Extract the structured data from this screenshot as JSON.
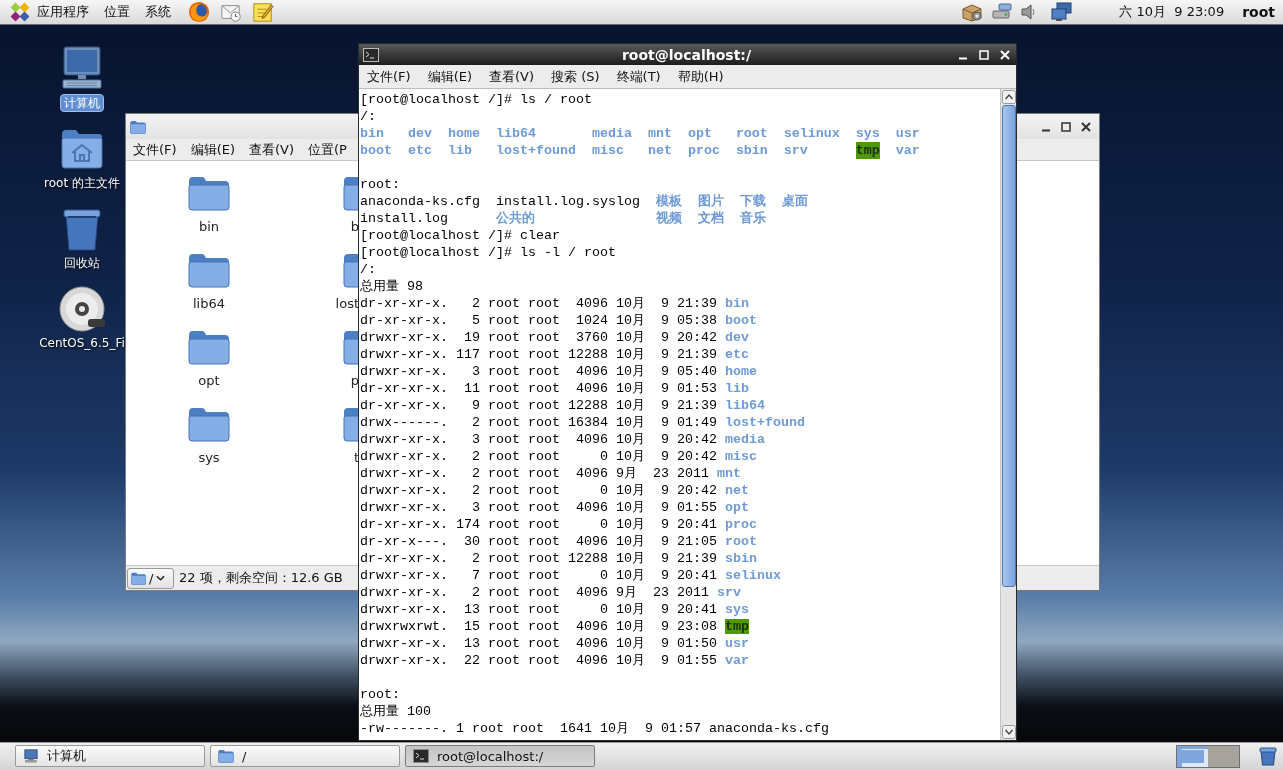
{
  "top_panel": {
    "menus": [
      "应用程序",
      "位置",
      "系统"
    ],
    "clock": "六 10月  9 23:09",
    "user": "root"
  },
  "desktop_icons": [
    {
      "kind": "computer",
      "label": "计算机",
      "selected": true
    },
    {
      "kind": "home",
      "label": "root 的主文件",
      "selected": false
    },
    {
      "kind": "trash",
      "label": "回收站",
      "selected": false
    },
    {
      "kind": "disc",
      "label": "CentOS_6.5_Fi",
      "selected": false
    }
  ],
  "file_manager": {
    "menu": [
      "文件(F)",
      "编辑(E)",
      "查看(V)",
      "位置(P"
    ],
    "rows": [
      [
        "bin",
        "b"
      ],
      [
        "lib64",
        "lost"
      ],
      [
        "opt",
        "p"
      ],
      [
        "sys",
        "t"
      ]
    ],
    "path": "/",
    "status": "22 项，剩余空间：12.6 GB"
  },
  "terminal": {
    "title": "root@localhost:/",
    "menu": [
      "文件(F)",
      "编辑(E)",
      "查看(V)",
      "搜索 (S)",
      "终端(T)",
      "帮助(H)"
    ],
    "lines": [
      {
        "kind": "text",
        "text": "[root@localhost /]# ls / root"
      },
      {
        "kind": "text",
        "text": "/:"
      },
      {
        "kind": "grid",
        "rows": [
          [
            {
              "name": "bin",
              "kind": "dir"
            },
            {
              "name": "dev",
              "kind": "dir"
            },
            {
              "name": "home",
              "kind": "dir"
            },
            {
              "name": "lib64",
              "kind": "dir"
            },
            {
              "name": "media",
              "kind": "dir"
            },
            {
              "name": "mnt",
              "kind": "dir"
            },
            {
              "name": "opt",
              "kind": "dir"
            },
            {
              "name": "root",
              "kind": "dir"
            },
            {
              "name": "selinux",
              "kind": "dir"
            },
            {
              "name": "sys",
              "kind": "dir"
            },
            {
              "name": "usr",
              "kind": "dir"
            }
          ],
          [
            {
              "name": "boot",
              "kind": "dir"
            },
            {
              "name": "etc",
              "kind": "dir"
            },
            {
              "name": "lib",
              "kind": "dir"
            },
            {
              "name": "lost+found",
              "kind": "dir"
            },
            {
              "name": "misc",
              "kind": "dir"
            },
            {
              "name": "net",
              "kind": "dir"
            },
            {
              "name": "proc",
              "kind": "dir"
            },
            {
              "name": "sbin",
              "kind": "dir"
            },
            {
              "name": "srv",
              "kind": "dir"
            },
            {
              "name": "tmp",
              "kind": "sticky"
            },
            {
              "name": "var",
              "kind": "dir"
            }
          ]
        ]
      },
      {
        "kind": "blank"
      },
      {
        "kind": "text",
        "text": "root:"
      },
      {
        "kind": "grid",
        "rows": [
          [
            {
              "name": "anaconda-ks.cfg",
              "kind": "file"
            },
            {
              "name": "install.log.syslog",
              "kind": "file"
            },
            {
              "name": "模板",
              "kind": "dir"
            },
            {
              "name": "图片",
              "kind": "dir"
            },
            {
              "name": "下载",
              "kind": "dir"
            },
            {
              "name": "桌面",
              "kind": "dir"
            }
          ],
          [
            {
              "name": "install.log",
              "kind": "file"
            },
            {
              "name": "公共的",
              "kind": "dir"
            },
            {
              "name": "视频",
              "kind": "dir"
            },
            {
              "name": "文档",
              "kind": "dir"
            },
            {
              "name": "音乐",
              "kind": "dir"
            }
          ]
        ]
      },
      {
        "kind": "text",
        "text": "[root@localhost /]# clear"
      },
      {
        "kind": "text",
        "text": "[root@localhost /]# ls -l / root"
      },
      {
        "kind": "text",
        "text": "/:"
      },
      {
        "kind": "text",
        "text": "总用量 98"
      },
      {
        "kind": "long",
        "details": "dr-xr-xr-x.   2 root root  4096 10月  9 21:39",
        "entry": {
          "name": "bin",
          "kind": "dir"
        }
      },
      {
        "kind": "long",
        "details": "dr-xr-xr-x.   5 root root  1024 10月  9 05:38",
        "entry": {
          "name": "boot",
          "kind": "dir"
        }
      },
      {
        "kind": "long",
        "details": "drwxr-xr-x.  19 root root  3760 10月  9 20:42",
        "entry": {
          "name": "dev",
          "kind": "dir"
        }
      },
      {
        "kind": "long",
        "details": "drwxr-xr-x. 117 root root 12288 10月  9 21:39",
        "entry": {
          "name": "etc",
          "kind": "dir"
        }
      },
      {
        "kind": "long",
        "details": "drwxr-xr-x.   3 root root  4096 10月  9 05:40",
        "entry": {
          "name": "home",
          "kind": "dir"
        }
      },
      {
        "kind": "long",
        "details": "dr-xr-xr-x.  11 root root  4096 10月  9 01:53",
        "entry": {
          "name": "lib",
          "kind": "dir"
        }
      },
      {
        "kind": "long",
        "details": "dr-xr-xr-x.   9 root root 12288 10月  9 21:39",
        "entry": {
          "name": "lib64",
          "kind": "dir"
        }
      },
      {
        "kind": "long",
        "details": "drwx------.   2 root root 16384 10月  9 01:49",
        "entry": {
          "name": "lost+found",
          "kind": "dir"
        }
      },
      {
        "kind": "long",
        "details": "drwxr-xr-x.   3 root root  4096 10月  9 20:42",
        "entry": {
          "name": "media",
          "kind": "dir"
        }
      },
      {
        "kind": "long",
        "details": "drwxr-xr-x.   2 root root     0 10月  9 20:42",
        "entry": {
          "name": "misc",
          "kind": "dir"
        }
      },
      {
        "kind": "long",
        "details": "drwxr-xr-x.   2 root root  4096 9月  23 2011",
        "entry": {
          "name": "mnt",
          "kind": "dir"
        }
      },
      {
        "kind": "long",
        "details": "drwxr-xr-x.   2 root root     0 10月  9 20:42",
        "entry": {
          "name": "net",
          "kind": "dir"
        }
      },
      {
        "kind": "long",
        "details": "drwxr-xr-x.   3 root root  4096 10月  9 01:55",
        "entry": {
          "name": "opt",
          "kind": "dir"
        }
      },
      {
        "kind": "long",
        "details": "dr-xr-xr-x. 174 root root     0 10月  9 20:41",
        "entry": {
          "name": "proc",
          "kind": "dir"
        }
      },
      {
        "kind": "long",
        "details": "dr-xr-x---.  30 root root  4096 10月  9 21:05",
        "entry": {
          "name": "root",
          "kind": "dir"
        }
      },
      {
        "kind": "long",
        "details": "dr-xr-xr-x.   2 root root 12288 10月  9 21:39",
        "entry": {
          "name": "sbin",
          "kind": "dir"
        }
      },
      {
        "kind": "long",
        "details": "drwxr-xr-x.   7 root root     0 10月  9 20:41",
        "entry": {
          "name": "selinux",
          "kind": "dir"
        }
      },
      {
        "kind": "long",
        "details": "drwxr-xr-x.   2 root root  4096 9月  23 2011",
        "entry": {
          "name": "srv",
          "kind": "dir"
        }
      },
      {
        "kind": "long",
        "details": "drwxr-xr-x.  13 root root     0 10月  9 20:41",
        "entry": {
          "name": "sys",
          "kind": "dir"
        }
      },
      {
        "kind": "long",
        "details": "drwxrwxrwt.  15 root root  4096 10月  9 23:08",
        "entry": {
          "name": "tmp",
          "kind": "sticky"
        }
      },
      {
        "kind": "long",
        "details": "drwxr-xr-x.  13 root root  4096 10月  9 01:50",
        "entry": {
          "name": "usr",
          "kind": "dir"
        }
      },
      {
        "kind": "long",
        "details": "drwxr-xr-x.  22 root root  4096 10月  9 01:55",
        "entry": {
          "name": "var",
          "kind": "dir"
        }
      },
      {
        "kind": "blank"
      },
      {
        "kind": "text",
        "text": "root:"
      },
      {
        "kind": "text",
        "text": "总用量 100"
      },
      {
        "kind": "long",
        "details": "-rw-------. 1 root root  1641 10月  9 01:57",
        "entry": {
          "name": "anaconda-ks.cfg",
          "kind": "file"
        }
      }
    ]
  },
  "taskbar": {
    "buttons": [
      {
        "kind": "computer",
        "label": "计算机",
        "selected": false
      },
      {
        "kind": "folder",
        "label": "/",
        "selected": false
      },
      {
        "kind": "terminal",
        "label": "root@localhost:/",
        "selected": true
      }
    ],
    "workspaces": [
      {
        "selected": true
      },
      {
        "selected": false
      }
    ]
  }
}
